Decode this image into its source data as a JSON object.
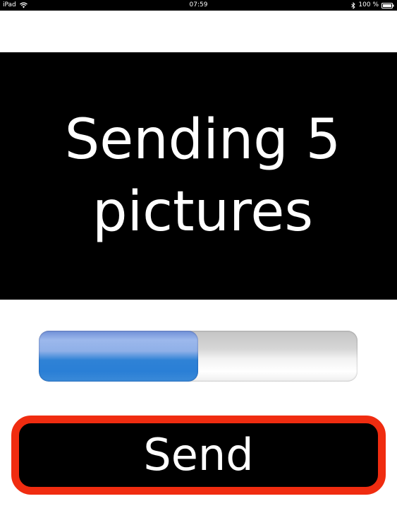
{
  "status_bar": {
    "device": "iPad",
    "time": "07:59",
    "battery_text": "100 %",
    "icons": [
      "wifi-icon",
      "bluetooth-icon",
      "battery-icon"
    ]
  },
  "message": {
    "text": "Sending 5 pictures"
  },
  "progress": {
    "fraction": 0.5,
    "fill_color": "#2f82d6"
  },
  "send_button": {
    "label": "Send",
    "border_color": "#f02c10"
  }
}
